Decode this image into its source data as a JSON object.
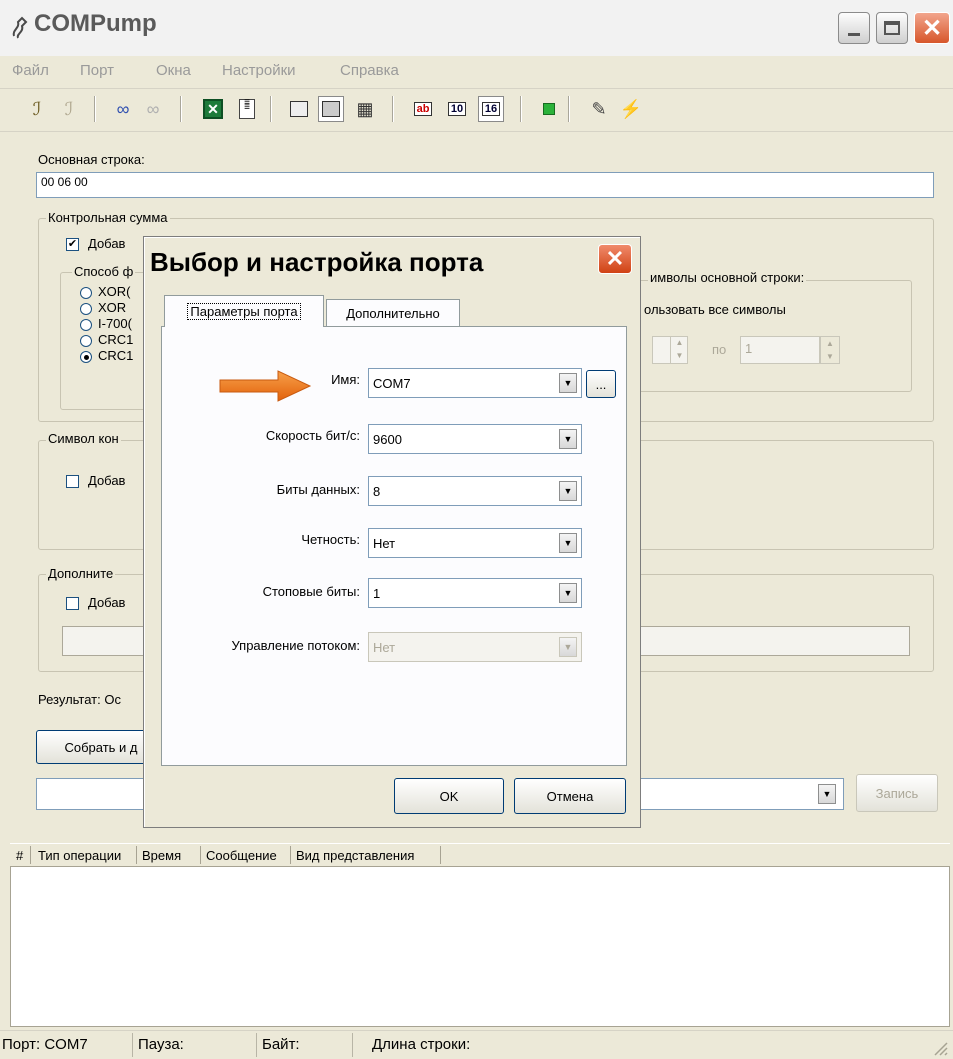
{
  "window": {
    "title": "COMPump"
  },
  "menu": [
    "Файл",
    "Порт",
    "Окна",
    "Настройки",
    "Справка"
  ],
  "toolbar": {
    "icons": [
      "port-open-icon",
      "port-close-icon",
      "connect-icon",
      "disconnect-icon",
      "excel-icon",
      "notepad-icon",
      "view1-icon",
      "view2-icon",
      "pattern-icon",
      "ab-icon",
      "dec-10-icon",
      "hex-16-icon",
      "green-square-icon",
      "settings-tool-icon",
      "plug-icon"
    ],
    "text": {
      "ab": "ab",
      "dec": "10",
      "hex": "16"
    }
  },
  "main": {
    "main_string_label": "Основная строка:",
    "main_string_value": "00 06 00",
    "checksum_group": "Контрольная сумма",
    "checksum_add": "Добав",
    "method_group": "Способ ф",
    "radios": [
      "XOR(",
      "XOR",
      "I-700(",
      "CRC1",
      "CRC1"
    ],
    "selected_radio": 4,
    "symbols_group": "имволы основной строки:",
    "use_all_symbols": "ользовать все символы",
    "range_from": "",
    "range_to_label": "по",
    "range_to_value": "1",
    "end_symbol_group": "Символ кон",
    "end_symbol_add": "Добав",
    "extra_group": "Дополните",
    "extra_add": "Добав",
    "result_label": "Результат: Ос",
    "build_button": "Собрать и д",
    "write_button": "Запись"
  },
  "log": {
    "columns": [
      "#",
      "Тип операции",
      "Время",
      "Сообщение",
      "Вид представления"
    ]
  },
  "status": {
    "port": "Порт: COM7",
    "pause": "Пауза:",
    "bytes": "Байт:",
    "length": "Длина строки:"
  },
  "dialog": {
    "title": "Выбор и настройка порта",
    "tabs": [
      "Параметры порта",
      "Дополнительно"
    ],
    "active_tab": 0,
    "fields": [
      {
        "label": "Имя:",
        "value": "COM7",
        "enabled": true
      },
      {
        "label": "Скорость бит/с:",
        "value": "9600",
        "enabled": true
      },
      {
        "label": "Биты данных:",
        "value": "8",
        "enabled": true
      },
      {
        "label": "Четность:",
        "value": "Нет",
        "enabled": true
      },
      {
        "label": "Стоповые биты:",
        "value": "1",
        "enabled": true
      },
      {
        "label": "Управление потоком:",
        "value": "Нет",
        "enabled": false
      }
    ],
    "browse_button": "...",
    "ok_button": "OK",
    "cancel_button": "Отмена",
    "arrow_color": "#f07818"
  },
  "colors": {
    "window_bg": "#ece9d8",
    "close_red": "#d04214",
    "input_border": "#7f9db9"
  }
}
